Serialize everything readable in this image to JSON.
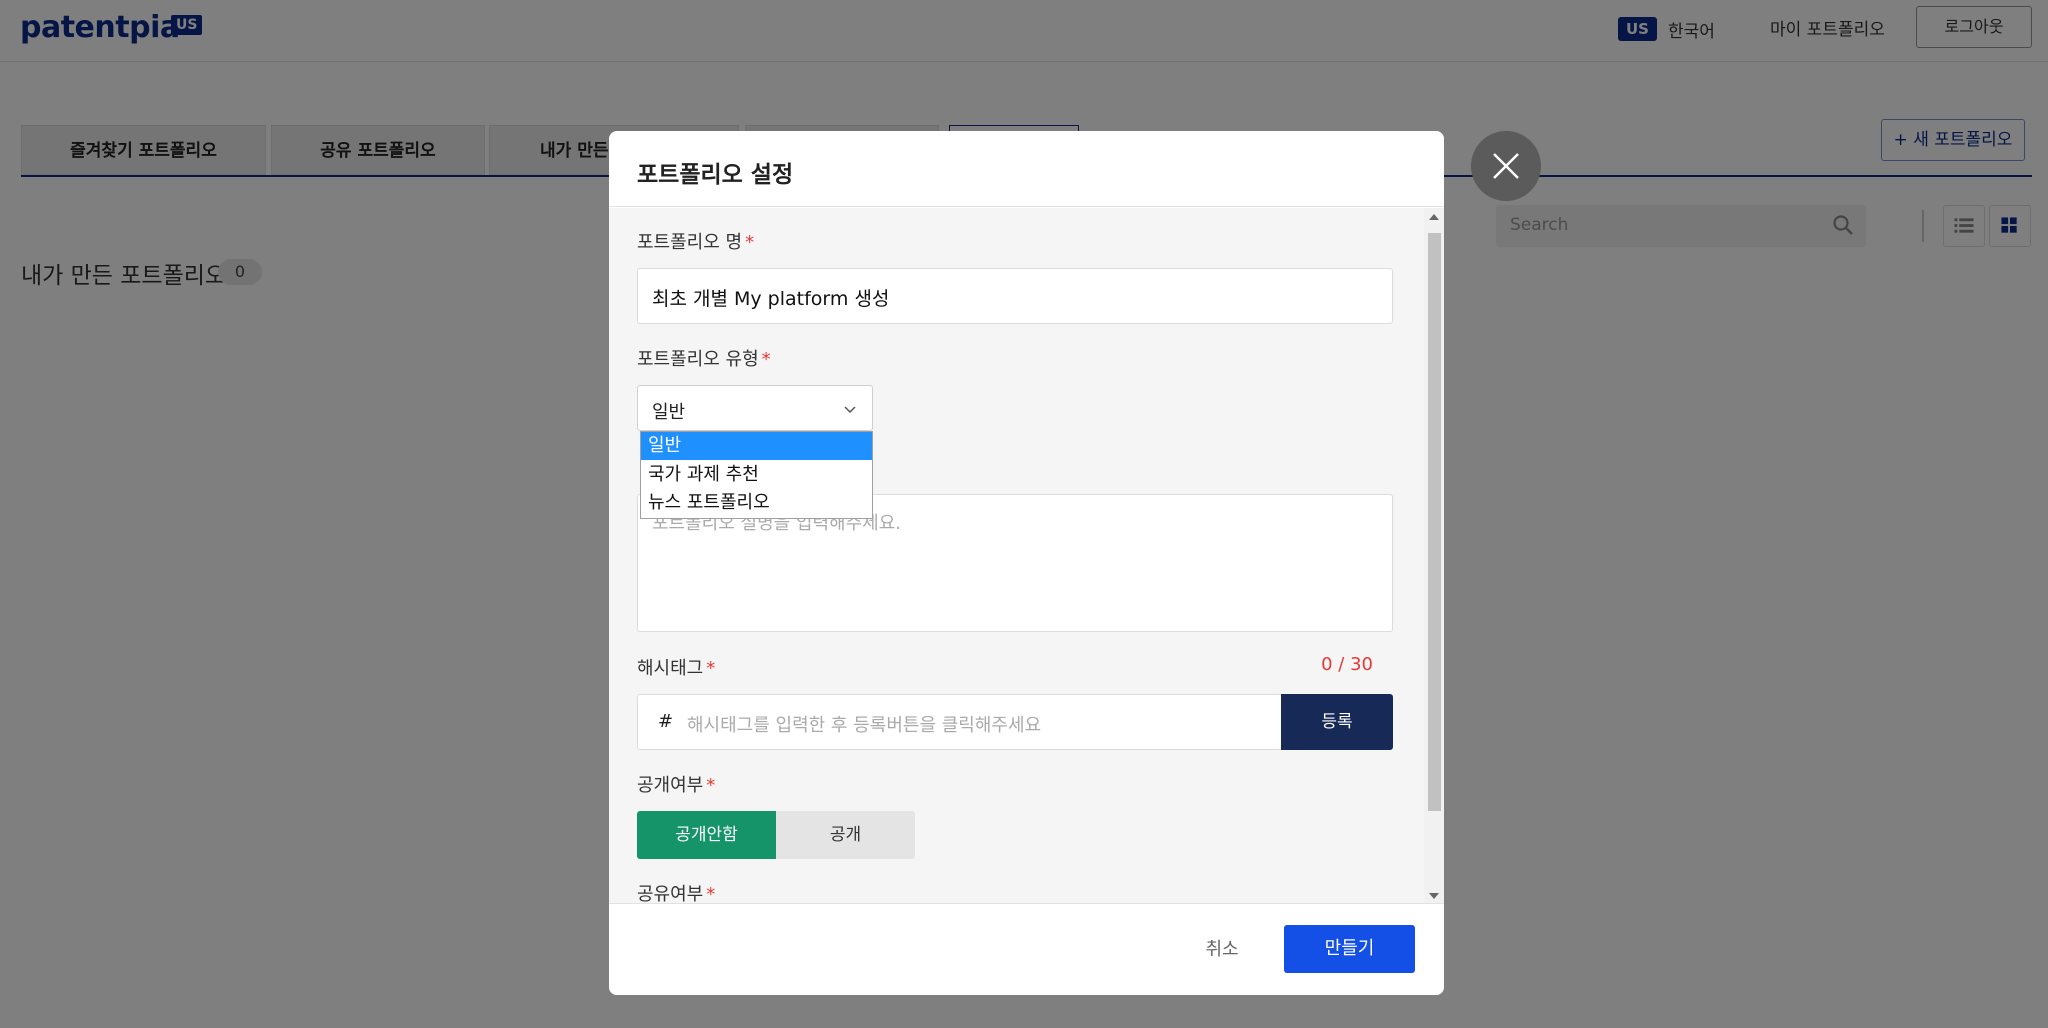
{
  "header": {
    "logo": "patentpia",
    "logo_badge": "US",
    "lang_badge": "US",
    "lang_label": "한국어",
    "my_portfolio": "마이 포트폴리오",
    "logout": "로그아웃"
  },
  "tabs": [
    {
      "label": "즐겨찾기 포트폴리오"
    },
    {
      "label": "공유 포트폴리오"
    },
    {
      "label": "내가 만든"
    }
  ],
  "new_portfolio_button": "+ 새 포트폴리오",
  "search": {
    "placeholder": "Search"
  },
  "page": {
    "heading": "내가 만든 포트폴리오",
    "count": "0"
  },
  "modal": {
    "title": "포트폴리오 설정",
    "name_label": "포트폴리오 명",
    "name_value": "최초 개별 My platform 생성",
    "type_label": "포트폴리오 유형",
    "type_value": "일반",
    "type_options": [
      "일반",
      "국가 과제 추천",
      "뉴스 포트폴리오"
    ],
    "description_placeholder": "포트폴리오 설명을 입력해주세요.",
    "hashtag_label": "해시태그",
    "hashtag_counter": "0 / 30",
    "hashtag_symbol": "#",
    "hashtag_placeholder": "해시태그를 입력한 후 등록버튼을 클릭해주세요",
    "register_button": "등록",
    "public_label": "공개여부",
    "public_options": [
      "공개안함",
      "공개"
    ],
    "share_label": "공유여부",
    "required_mark": "*",
    "cancel_button": "취소",
    "create_button": "만들기"
  },
  "colors": {
    "brand": "#0b2a8a",
    "primary_button": "#1550e6",
    "register_button": "#172957",
    "toggle_active": "#15946a",
    "required": "#e53935",
    "dropdown_highlight": "#1e90ff"
  },
  "icons": {
    "search": "search-icon",
    "close": "close-icon",
    "chevron": "chevron-down-icon",
    "list_view": "list-view-icon",
    "grid_view": "grid-view-icon"
  }
}
